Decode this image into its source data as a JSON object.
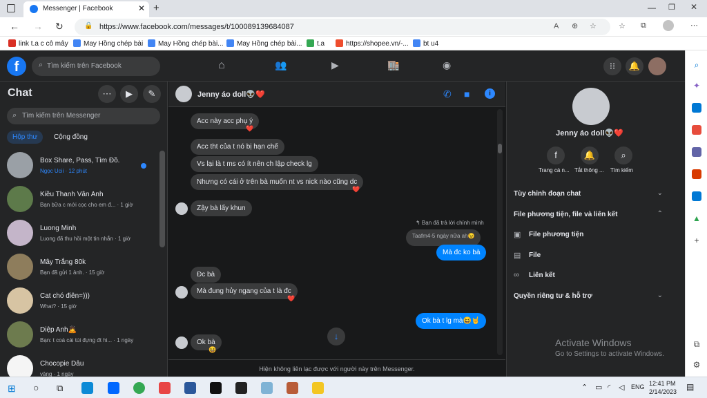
{
  "browser": {
    "tab_title": "Messenger | Facebook",
    "url": "https://www.facebook.com/messages/t/100089139684087",
    "bookmarks": [
      "link t.a c cô mây",
      "May Hồng chép bài",
      "May Hồng chép bài...",
      "May Hồng chép bài...",
      "t.a",
      "https://shopee.vn/-...",
      "bt u4"
    ]
  },
  "fb_nav": {
    "search_placeholder": "Tìm kiếm trên Facebook"
  },
  "left": {
    "title": "Chat",
    "search_placeholder": "Tìm kiếm trên Messenger",
    "tabs": [
      "Hộp thư",
      "Cộng đồng"
    ],
    "conversations": [
      {
        "name": "Box Share, Pass, Tìm Đồ.",
        "preview": "Ngọc Ucii · 12 phút"
      },
      {
        "name": "Kiều Thanh Vân Anh",
        "preview": "Bạn bữa c mới cọc cho em đ... · 1 giờ"
      },
      {
        "name": "Luong Minh",
        "preview": "Luong đã thu hồi một tin nhắn · 1 giờ"
      },
      {
        "name": "Mây Trắng 80k",
        "preview": "Bạn đã gửi 1 ảnh. · 15 giờ"
      },
      {
        "name": "Cat chó điên=)))",
        "preview": "What? · 15 giờ"
      },
      {
        "name": "Diệp Anh🙇",
        "preview": "Bạn: t coá cái túi đựng đt hi... · 1 ngày"
      },
      {
        "name": "Chocopie Dâu",
        "preview": "vâng · 1 ngày"
      }
    ]
  },
  "chat": {
    "contact": "Jenny áo doll👽❤️",
    "messages": [
      {
        "text": "Acc này acc phụ ý",
        "mine": false,
        "react": "❤️"
      },
      {
        "text": "Acc tht của t nó bị hạn chế",
        "mine": false
      },
      {
        "text": "Vs lại là t ms có ít nên ch lập check lg",
        "mine": false
      },
      {
        "text": "Nhưng có cái ở trên bà muốn nt vs nick nào cũng dc",
        "mine": false,
        "react": "❤️"
      },
      {
        "text": "Zậy bà lấy khun",
        "mine": false
      },
      {
        "text": "Taafm4-5 ngày nữa ah😉",
        "mine": true,
        "reply": true
      },
      {
        "text": "Mà đc ko bà",
        "mine": true
      },
      {
        "text": "Đc bà",
        "mine": false
      },
      {
        "text": "Mà đung hủy ngang của t là đc",
        "mine": false,
        "react": "❤️"
      },
      {
        "text": "Ok bà t lg mà😆🤘",
        "mine": true
      },
      {
        "text": "Ok bà",
        "mine": false,
        "react": "😆"
      }
    ],
    "reply_note": "↰ Bạn đã trả lời chính mình",
    "footer": "Hiện không liên lạc được với người này trên Messenger."
  },
  "right": {
    "name": "Jenny áo doll👽❤️",
    "actions": [
      "Trang cá n...",
      "Tắt thông ...",
      "Tìm kiếm"
    ],
    "sections": [
      "Tùy chỉnh đoạn chat",
      "File phương tiện, file và liên kết",
      "File phương tiện",
      "File",
      "Liên kết",
      "Quyền riêng tư & hỗ trợ"
    ],
    "watermark_title": "Activate Windows",
    "watermark_sub": "Go to Settings to activate Windows."
  },
  "taskbar": {
    "time": "12:41 PM",
    "date": "2/14/2023",
    "lang": "ENG"
  }
}
